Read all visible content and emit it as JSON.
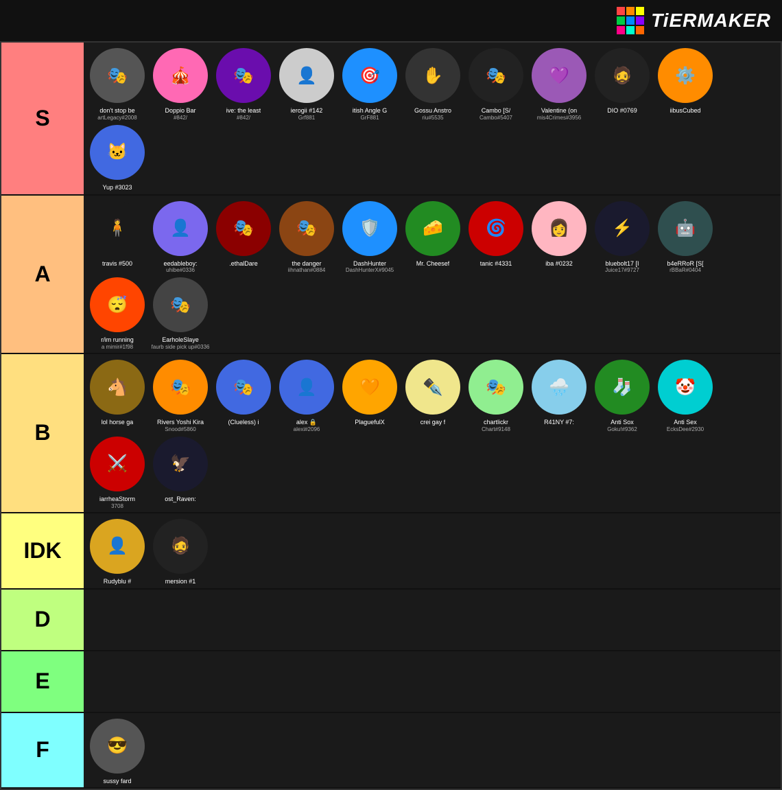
{
  "header": {
    "logo_text": "TiERMAKER"
  },
  "tiers": [
    {
      "id": "s",
      "label": "S",
      "color": "#ff7f7f",
      "items": [
        {
          "name": "don't stop be",
          "sub": "artLegacy#2008",
          "bg": "#555",
          "emoji": "🎭"
        },
        {
          "name": "Doppio Bar",
          "sub": "#842/",
          "bg": "#ff69b4",
          "emoji": "🎪"
        },
        {
          "name": "ive: the least",
          "sub": "#842/",
          "bg": "#6a0dad",
          "emoji": "🎭"
        },
        {
          "name": "ierogii #142",
          "sub": "Grf881",
          "bg": "#ccc",
          "emoji": "👤"
        },
        {
          "name": "itish Angle G",
          "sub": "GrF881",
          "bg": "#1e90ff",
          "emoji": "🎯"
        },
        {
          "name": "Gossu Anstro",
          "sub": "riu#5535",
          "bg": "#333",
          "emoji": "✋"
        },
        {
          "name": "Cambo [S/",
          "sub": "Cambo#5407",
          "bg": "#222",
          "emoji": "🎭"
        },
        {
          "name": "Valentine (on",
          "sub": "mis4Crimes#3956",
          "bg": "#9b59b6",
          "emoji": "💜"
        },
        {
          "name": "DIO #0769",
          "sub": "",
          "bg": "#222",
          "emoji": "🧔"
        },
        {
          "name": "iibusCubed",
          "sub": "",
          "bg": "#ff8c00",
          "emoji": "⚙️"
        },
        {
          "name": "Yup #3023",
          "sub": "",
          "bg": "#4169e1",
          "emoji": "🐱"
        }
      ]
    },
    {
      "id": "a",
      "label": "A",
      "color": "#ffbf7f",
      "items": [
        {
          "name": "travis #500",
          "sub": "",
          "bg": "#1a1a1a",
          "emoji": "🧍"
        },
        {
          "name": "eedableboy:",
          "sub": "uhibe#0336",
          "bg": "#7b68ee",
          "emoji": "👤"
        },
        {
          "name": ".ethalDare",
          "sub": "",
          "bg": "#8B0000",
          "emoji": "🎭"
        },
        {
          "name": "the danger",
          "sub": "iihnathan#0884",
          "bg": "#8B4513",
          "emoji": "🎭"
        },
        {
          "name": "DashHunter",
          "sub": "DashHunterX#9045",
          "bg": "#1e90ff",
          "emoji": "🛡️"
        },
        {
          "name": "Mr. Cheesef",
          "sub": "",
          "bg": "#228B22",
          "emoji": "🧀"
        },
        {
          "name": "tanic #4331",
          "sub": "",
          "bg": "#cc0000",
          "emoji": "🌀"
        },
        {
          "name": "iba #0232",
          "sub": "",
          "bg": "#ffb6c1",
          "emoji": "👩"
        },
        {
          "name": "bluebolt17 [I",
          "sub": "Juice17#9727",
          "bg": "#1a1a2e",
          "emoji": "⚡"
        },
        {
          "name": "b4eRRoR [S[",
          "sub": "rBBaR#0404",
          "bg": "#2f4f4f",
          "emoji": "🤖"
        },
        {
          "name": "r/im running",
          "sub": "a mimir#1f98",
          "bg": "#ff4500",
          "emoji": "😴"
        },
        {
          "name": "EarholeSlaye",
          "sub": "faurb side pick up#0336",
          "bg": "#444",
          "emoji": "🎭"
        }
      ]
    },
    {
      "id": "b",
      "label": "B",
      "color": "#ffdf7f",
      "items": [
        {
          "name": "lol horse ga",
          "sub": "",
          "bg": "#8B6914",
          "emoji": "🐴"
        },
        {
          "name": "Rivers Yoshi Kira",
          "sub": "Snood#5860",
          "bg": "#ff8c00",
          "emoji": "🎭"
        },
        {
          "name": "(Clueless) i",
          "sub": "",
          "bg": "#4169e1",
          "emoji": "🎭"
        },
        {
          "name": "alex 🔒",
          "sub": "alexi#2096",
          "bg": "#4169e1",
          "emoji": "👤"
        },
        {
          "name": "PlaguefulX",
          "sub": "",
          "bg": "#ffa500",
          "emoji": "🧡"
        },
        {
          "name": "crei gay f",
          "sub": "",
          "bg": "#f0e68c",
          "emoji": "✒️"
        },
        {
          "name": "chartlickr",
          "sub": "Chart#9148",
          "bg": "#90ee90",
          "emoji": "🎭"
        },
        {
          "name": "R41NY #7:",
          "sub": "",
          "bg": "#87ceeb",
          "emoji": "🌧️"
        },
        {
          "name": "Anti Sox",
          "sub": "Goku!#9362",
          "bg": "#228B22",
          "emoji": "🧦"
        },
        {
          "name": "Anti Sex",
          "sub": "EcksDee#2930",
          "bg": "#00ced1",
          "emoji": "🤡"
        },
        {
          "name": "iarrheaStorm",
          "sub": "3708",
          "bg": "#cc0000",
          "emoji": "⚔️"
        },
        {
          "name": "ost_Raven:",
          "sub": "",
          "bg": "#1a1a2e",
          "emoji": "🦅"
        }
      ]
    },
    {
      "id": "idk",
      "label": "IDK",
      "color": "#ffff7f",
      "items": [
        {
          "name": "Rudyblu #",
          "sub": "",
          "bg": "#daa520",
          "emoji": "👤"
        },
        {
          "name": "mersion #1",
          "sub": "",
          "bg": "#222",
          "emoji": "🧔"
        }
      ]
    },
    {
      "id": "d",
      "label": "D",
      "color": "#bfff7f",
      "items": []
    },
    {
      "id": "e",
      "label": "E",
      "color": "#7fff7f",
      "items": []
    },
    {
      "id": "f",
      "label": "F",
      "color": "#7fffff",
      "items": [
        {
          "name": "sussy fard",
          "sub": "",
          "bg": "#555",
          "emoji": "😎"
        }
      ]
    }
  ],
  "logo_colors": [
    "#ff4444",
    "#ff8800",
    "#ffff00",
    "#00cc44",
    "#0088ff",
    "#8800ff",
    "#ff0088",
    "#00ffcc",
    "#ff6600"
  ]
}
